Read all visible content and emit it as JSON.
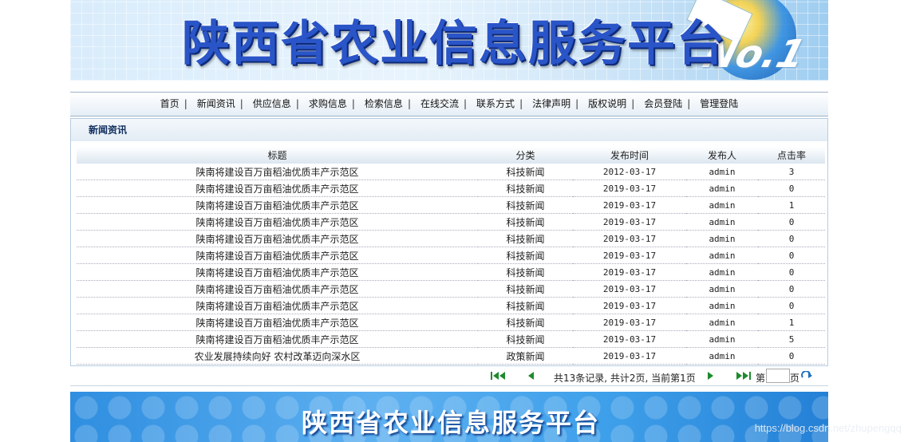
{
  "banner": {
    "title": "陕西省农业信息服务平台",
    "badge": "No.1"
  },
  "nav": [
    "首页",
    "新闻资讯",
    "供应信息",
    "求购信息",
    "检索信息",
    "在线交流",
    "联系方式",
    "法律声明",
    "版权说明",
    "会员登陆",
    "管理登陆"
  ],
  "panel": {
    "title": "新闻资讯"
  },
  "table": {
    "headers": [
      "标题",
      "分类",
      "发布时间",
      "发布人",
      "点击率"
    ],
    "rows": [
      [
        "陕南将建设百万亩稻油优质丰产示范区",
        "科技新闻",
        "2012-03-17",
        "admin",
        "3"
      ],
      [
        "陕南将建设百万亩稻油优质丰产示范区",
        "科技新闻",
        "2019-03-17",
        "admin",
        "0"
      ],
      [
        "陕南将建设百万亩稻油优质丰产示范区",
        "科技新闻",
        "2019-03-17",
        "admin",
        "1"
      ],
      [
        "陕南将建设百万亩稻油优质丰产示范区",
        "科技新闻",
        "2019-03-17",
        "admin",
        "0"
      ],
      [
        "陕南将建设百万亩稻油优质丰产示范区",
        "科技新闻",
        "2019-03-17",
        "admin",
        "0"
      ],
      [
        "陕南将建设百万亩稻油优质丰产示范区",
        "科技新闻",
        "2019-03-17",
        "admin",
        "0"
      ],
      [
        "陕南将建设百万亩稻油优质丰产示范区",
        "科技新闻",
        "2019-03-17",
        "admin",
        "0"
      ],
      [
        "陕南将建设百万亩稻油优质丰产示范区",
        "科技新闻",
        "2019-03-17",
        "admin",
        "0"
      ],
      [
        "陕南将建设百万亩稻油优质丰产示范区",
        "科技新闻",
        "2019-03-17",
        "admin",
        "0"
      ],
      [
        "陕南将建设百万亩稻油优质丰产示范区",
        "科技新闻",
        "2019-03-17",
        "admin",
        "1"
      ],
      [
        "陕南将建设百万亩稻油优质丰产示范区",
        "科技新闻",
        "2019-03-17",
        "admin",
        "5"
      ],
      [
        "农业发展持续向好 农村改革迈向深水区",
        "政策新闻",
        "2019-03-17",
        "admin",
        "0"
      ]
    ]
  },
  "pager": {
    "info": "共13条记录, 共计2页, 当前第1页",
    "page_prefix": "第",
    "page_suffix": "页",
    "page_value": ""
  },
  "footer": {
    "title": "陕西省农业信息服务平台"
  },
  "watermark": "https://blog.csdn.net/zhupengqq",
  "colors": {
    "nav_border": "#9fb3c8",
    "panel_border": "#b6cde2",
    "pager_icon": "#1e8a2e"
  }
}
